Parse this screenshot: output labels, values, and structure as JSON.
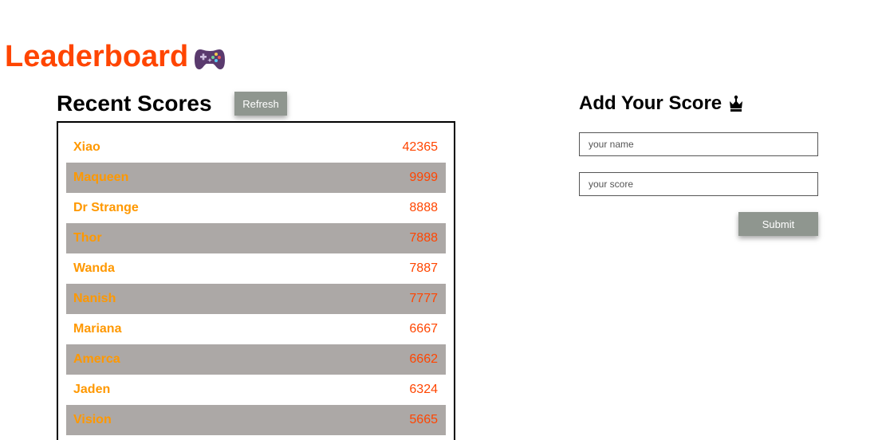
{
  "header": {
    "title": "Leaderboard",
    "icon": "gamepad-icon"
  },
  "recent": {
    "heading": "Recent Scores",
    "refresh_label": "Refresh",
    "scores": [
      {
        "name": "Xiao",
        "score": "42365"
      },
      {
        "name": "Maqueen",
        "score": "9999"
      },
      {
        "name": "Dr Strange",
        "score": "8888"
      },
      {
        "name": "Thor",
        "score": "7888"
      },
      {
        "name": "Wanda",
        "score": "7887"
      },
      {
        "name": "Nanish",
        "score": "7777"
      },
      {
        "name": "Mariana",
        "score": "6667"
      },
      {
        "name": "Amerca",
        "score": "6662"
      },
      {
        "name": "Jaden",
        "score": "6324"
      },
      {
        "name": "Vision",
        "score": "5665"
      }
    ]
  },
  "add_score": {
    "heading": "Add Your Score",
    "icon": "crown-icon",
    "name_placeholder": "your name",
    "score_placeholder": "your score",
    "submit_label": "Submit"
  },
  "colors": {
    "title": "#ff4500",
    "name": "#ff9800",
    "score": "#ff4500",
    "row_alt": "#aca8a6",
    "button": "#8f968f"
  }
}
